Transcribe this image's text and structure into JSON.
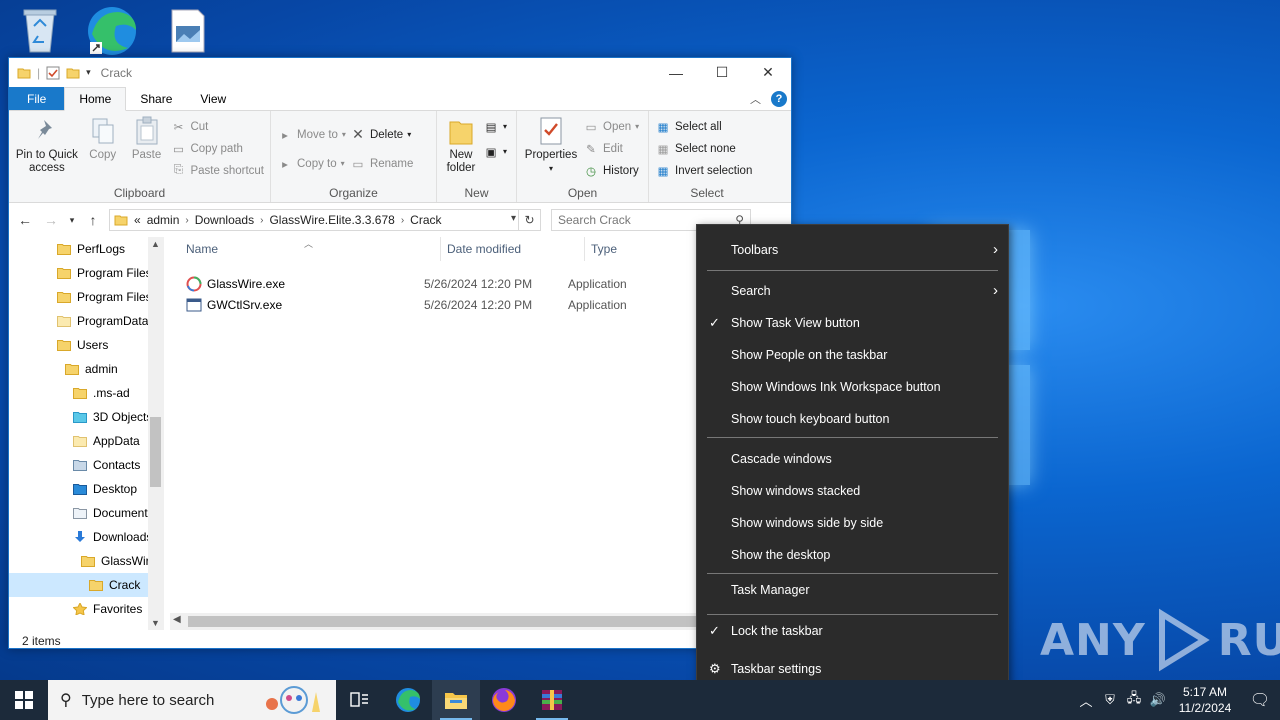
{
  "window": {
    "title": "Crack",
    "min_glyph": "—",
    "max_glyph": "☐",
    "close_glyph": "✕"
  },
  "ribbon_tabs": [
    "File",
    "Home",
    "Share",
    "View"
  ],
  "ribbon": {
    "clipboard": {
      "label": "Clipboard",
      "pin": "Pin to Quick access",
      "copy": "Copy",
      "paste": "Paste",
      "cut": "Cut",
      "copy_path": "Copy path",
      "paste_shortcut": "Paste shortcut"
    },
    "organize": {
      "label": "Organize",
      "move_to": "Move to",
      "copy_to": "Copy to",
      "delete": "Delete",
      "rename": "Rename"
    },
    "new": {
      "label": "New",
      "new_folder": "New folder"
    },
    "open": {
      "label": "Open",
      "properties": "Properties",
      "open": "Open",
      "edit": "Edit",
      "history": "History"
    },
    "select": {
      "label": "Select",
      "select_all": "Select all",
      "select_none": "Select none",
      "invert": "Invert selection"
    }
  },
  "address": {
    "overflow": "«",
    "crumbs": [
      "admin",
      "Downloads",
      "GlassWire.Elite.3.3.678",
      "Crack"
    ],
    "search_placeholder": "Search Crack"
  },
  "nav_pane": [
    {
      "label": "PerfLogs",
      "indent": 0,
      "icon": "folder"
    },
    {
      "label": "Program Files",
      "indent": 0,
      "icon": "folder"
    },
    {
      "label": "Program Files",
      "indent": 0,
      "icon": "folder"
    },
    {
      "label": "ProgramData",
      "indent": 0,
      "icon": "folder-light"
    },
    {
      "label": "Users",
      "indent": 0,
      "icon": "folder"
    },
    {
      "label": "admin",
      "indent": 1,
      "icon": "folder"
    },
    {
      "label": ".ms-ad",
      "indent": 2,
      "icon": "folder"
    },
    {
      "label": "3D Objects",
      "indent": 2,
      "icon": "3d-objects"
    },
    {
      "label": "AppData",
      "indent": 2,
      "icon": "folder-light"
    },
    {
      "label": "Contacts",
      "indent": 2,
      "icon": "contacts"
    },
    {
      "label": "Desktop",
      "indent": 2,
      "icon": "desktop"
    },
    {
      "label": "Documents",
      "indent": 2,
      "icon": "documents"
    },
    {
      "label": "Downloads",
      "indent": 2,
      "icon": "downloads"
    },
    {
      "label": "GlassWire",
      "indent": 3,
      "icon": "folder"
    },
    {
      "label": "Crack",
      "indent": 4,
      "icon": "folder",
      "selected": true
    },
    {
      "label": "Favorites",
      "indent": 2,
      "icon": "favorites"
    }
  ],
  "columns": [
    "Name",
    "Date modified",
    "Type"
  ],
  "files": [
    {
      "name": "GlassWire.exe",
      "date": "5/26/2024 12:20 PM",
      "type": "Application",
      "icon": "glasswire"
    },
    {
      "name": "GWCtlSrv.exe",
      "date": "5/26/2024 12:20 PM",
      "type": "Application",
      "icon": "exe"
    }
  ],
  "status": {
    "count": "2 items"
  },
  "context_menu": [
    {
      "label": "Toolbars",
      "submenu": true,
      "checked": false
    },
    {
      "sep": true
    },
    {
      "label": "Search",
      "submenu": true,
      "checked": false
    },
    {
      "label": "Show Task View button",
      "submenu": false,
      "checked": true
    },
    {
      "label": "Show People on the taskbar",
      "submenu": false,
      "checked": false
    },
    {
      "label": "Show Windows Ink Workspace button",
      "submenu": false,
      "checked": false
    },
    {
      "label": "Show touch keyboard button",
      "submenu": false,
      "checked": false
    },
    {
      "sep": true
    },
    {
      "label": "Cascade windows",
      "submenu": false,
      "checked": false
    },
    {
      "label": "Show windows stacked",
      "submenu": false,
      "checked": false
    },
    {
      "label": "Show windows side by side",
      "submenu": false,
      "checked": false
    },
    {
      "label": "Show the desktop",
      "submenu": false,
      "checked": false
    },
    {
      "sep": true
    },
    {
      "label": "Task Manager",
      "submenu": false,
      "checked": false
    },
    {
      "sep": true
    },
    {
      "label": "Lock the taskbar",
      "submenu": false,
      "checked": true
    },
    {
      "label": "Taskbar settings",
      "submenu": false,
      "checked": false,
      "gear": true
    }
  ],
  "taskbar": {
    "search_placeholder": "Type here to search",
    "time": "5:17 AM",
    "date": "11/2/2024"
  },
  "watermark": "ANY RUN"
}
